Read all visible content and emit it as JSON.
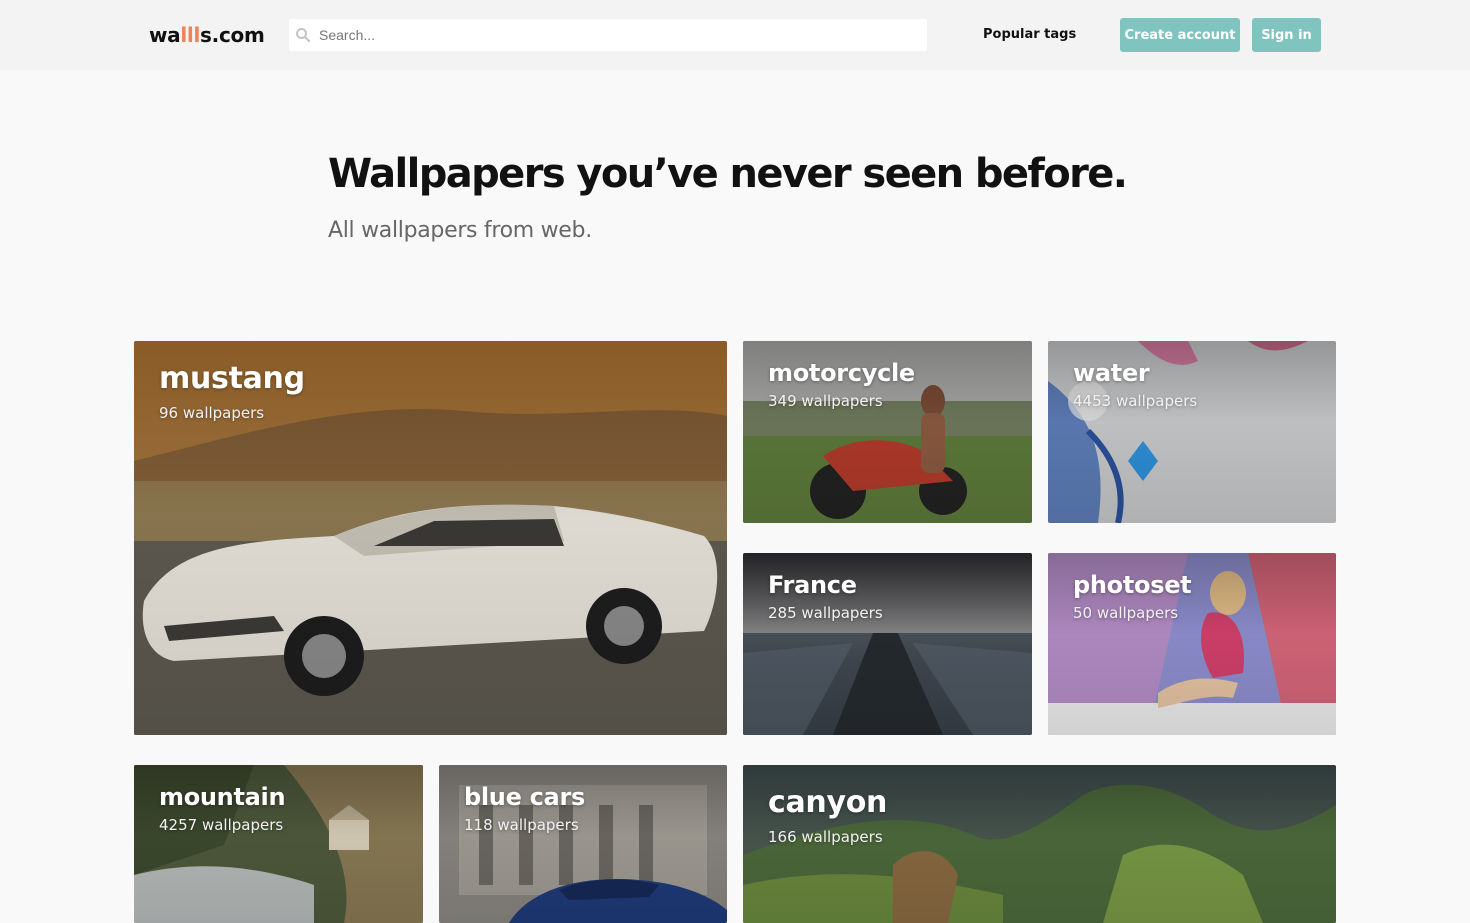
{
  "header": {
    "logo": {
      "pre": "wa",
      "accent": "lll",
      "post": "s.com"
    },
    "search": {
      "placeholder": "Search..."
    },
    "popular_tags_label": "Popular tags",
    "create_account_label": "Create account",
    "sign_in_label": "Sign in"
  },
  "hero": {
    "title": "Wallpapers you’ve never seen before.",
    "subtitle": "All wallpapers from web."
  },
  "tiles": [
    {
      "name": "mustang",
      "count": "96 wallpapers"
    },
    {
      "name": "motorcycle",
      "count": "349 wallpapers"
    },
    {
      "name": "water",
      "count": "4453 wallpapers"
    },
    {
      "name": "France",
      "count": "285 wallpapers"
    },
    {
      "name": "photoset",
      "count": "50 wallpapers"
    },
    {
      "name": "mountain",
      "count": "4257 wallpapers"
    },
    {
      "name": "blue cars",
      "count": "118 wallpapers"
    },
    {
      "name": "canyon",
      "count": "166 wallpapers"
    }
  ],
  "colors": {
    "accent_button": "#7fc4bf",
    "logo_accent": "#e9855a",
    "header_bg": "#f3f3f3",
    "page_bg": "#f9f9f9"
  },
  "icons": {
    "search": "search-icon"
  }
}
